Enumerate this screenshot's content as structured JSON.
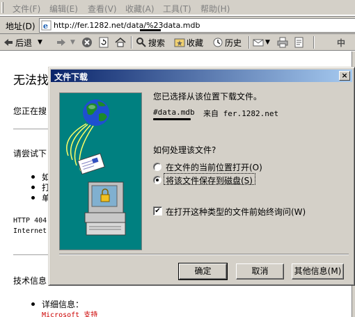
{
  "menu": [
    "文件(F)",
    "编辑(E)",
    "查看(V)",
    "收藏(A)",
    "工具(T)",
    "帮助(H)"
  ],
  "address": {
    "label": "地址(D)",
    "url": "http://fer.1282.net/data/%23data.mdb"
  },
  "toolbar": {
    "back": "后退",
    "search": "搜索",
    "favorites": "收藏",
    "history": "历史",
    "right_char": "中"
  },
  "page": {
    "title": "无法找",
    "line1": "您正在搜",
    "line2": "请尝试下",
    "bullets": [
      "如",
      "打",
      "单"
    ],
    "http_line1": "HTTP 404",
    "http_line2": "Internet",
    "tech": "技术信息",
    "detail_label": "详细信息：",
    "ms_link": "Microsoft 支持"
  },
  "dialog": {
    "title": "文件下载",
    "close": "×",
    "prompt": "您已选择从该位置下载文件。",
    "filename": "#data.mdb",
    "from": "来自 fer.1282.net",
    "question": "如何处理该文件?",
    "option_open": "在文件的当前位置打开(O)",
    "option_save": "将该文件保存到磁盘(S)",
    "always_ask": "在打开这种类型的文件前始终询问(W)",
    "always_ask_checked": true,
    "selected_option": "save",
    "ok": "确定",
    "cancel": "取消",
    "more_info": "其他信息(M)"
  },
  "colors": {
    "title_start": "#0a246a",
    "title_end": "#a6caf0",
    "art_bg": "#008080",
    "link": "#cc0000",
    "chrome": "#d4d0c8"
  }
}
